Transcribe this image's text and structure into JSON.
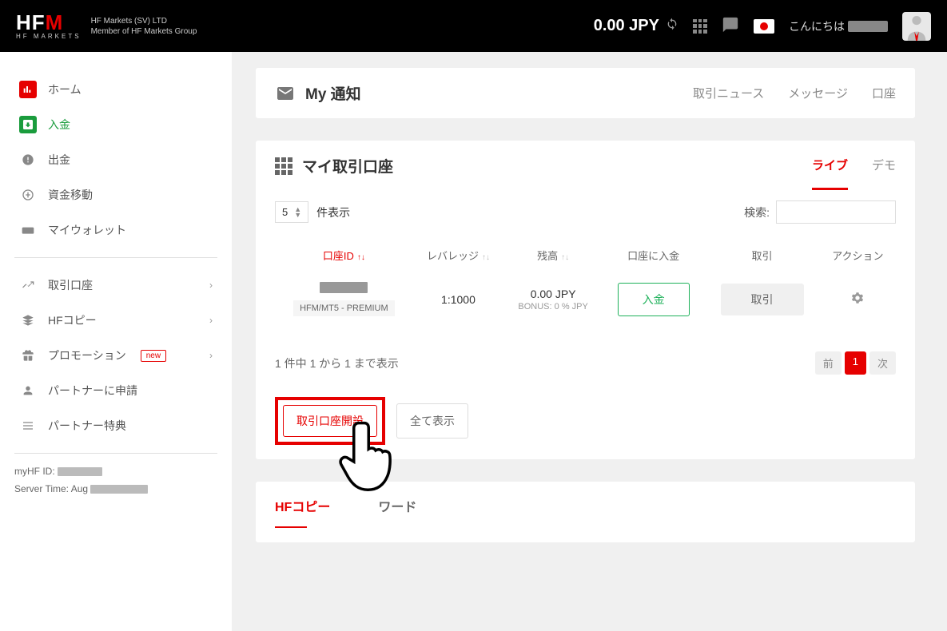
{
  "header": {
    "logo_main_1": "HF",
    "logo_main_2": "M",
    "logo_sub": "HF MARKETS",
    "company_line1": "HF Markets (SV) LTD",
    "company_line2": "Member of HF Markets Group",
    "balance": "0.00 JPY",
    "greeting": "こんにちは"
  },
  "sidebar": {
    "items": [
      {
        "label": "ホーム",
        "icon": "home"
      },
      {
        "label": "入金",
        "icon": "deposit",
        "active": true
      },
      {
        "label": "出金",
        "icon": "withdraw"
      },
      {
        "label": "資金移動",
        "icon": "transfer"
      },
      {
        "label": "マイウォレット",
        "icon": "wallet"
      }
    ],
    "items2": [
      {
        "label": "取引口座",
        "chev": true
      },
      {
        "label": "HFコピー",
        "chev": true
      },
      {
        "label": "プロモーション",
        "chev": true,
        "new": true
      },
      {
        "label": "パートナーに申請"
      },
      {
        "label": "パートナー特典"
      }
    ],
    "myhf_label": "myHF ID:",
    "server_label": "Server Time: Aug",
    "badge_new": "new"
  },
  "notifications": {
    "title": "My 通知",
    "tabs": [
      "取引ニュース",
      "メッセージ",
      "口座"
    ]
  },
  "accounts": {
    "title": "マイ取引口座",
    "tab_live": "ライブ",
    "tab_demo": "デモ",
    "page_size": "5",
    "page_size_suffix": "件表示",
    "search_label": "検索:",
    "columns": {
      "id": "口座ID",
      "leverage": "レバレッジ",
      "balance": "残高",
      "deposit": "口座に入金",
      "trade": "取引",
      "action": "アクション"
    },
    "row": {
      "id_tag": "HFM/MT5 - PREMIUM",
      "leverage": "1:1000",
      "balance": "0.00 JPY",
      "bonus_label": "BONUS:",
      "bonus_value": "0 % JPY",
      "deposit_btn": "入金",
      "trade_btn": "取引"
    },
    "footer_text": "1 件中 1 から 1 まで表示",
    "pager_prev": "前",
    "pager_1": "1",
    "pager_next": "次",
    "open_account_btn": "取引口座開設",
    "show_all_btn": "全て表示"
  },
  "hfcopy": {
    "title": "HFコピー",
    "word": "ワード"
  }
}
